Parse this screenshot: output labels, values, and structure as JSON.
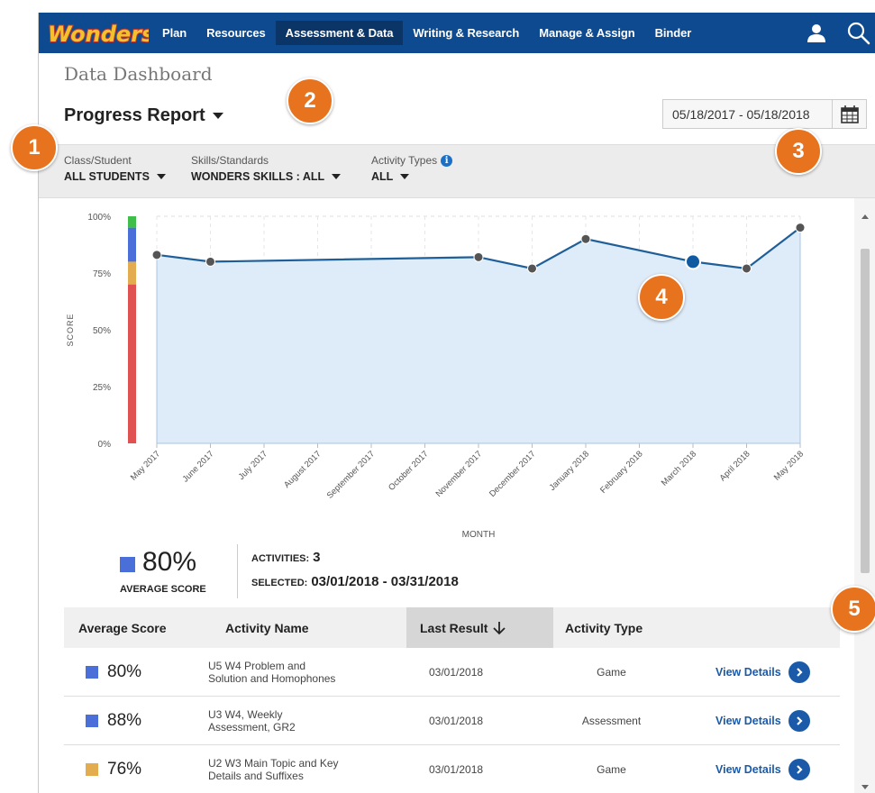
{
  "nav": {
    "logo_text": "Wonders",
    "items": [
      {
        "label": "Plan",
        "active": false
      },
      {
        "label": "Resources",
        "active": false
      },
      {
        "label": "Assessment & Data",
        "active": true
      },
      {
        "label": "Writing & Research",
        "active": false
      },
      {
        "label": "Manage & Assign",
        "active": false
      },
      {
        "label": "Binder",
        "active": false
      }
    ]
  },
  "header": {
    "dashboard_title": "Data Dashboard",
    "report_title": "Progress Report",
    "date_range": "05/18/2017 - 05/18/2018"
  },
  "filters": {
    "class_student_label": "Class/Student",
    "class_student_value": "ALL STUDENTS",
    "skills_label": "Skills/Standards",
    "skills_value": "WONDERS SKILLS : ALL",
    "activity_label": "Activity Types",
    "activity_value": "ALL"
  },
  "chart_data": {
    "type": "area",
    "ylabel": "SCORE",
    "xlabel": "MONTH",
    "ylim": [
      0,
      100
    ],
    "yticks": [
      "0%",
      "25%",
      "50%",
      "75%",
      "100%"
    ],
    "categories": [
      "May 2017",
      "June 2017",
      "July 2017",
      "August 2017",
      "September 2017",
      "October 2017",
      "November 2017",
      "December 2017",
      "January 2018",
      "February 2018",
      "March 2018",
      "April 2018",
      "May 2018"
    ],
    "points": [
      {
        "x": "May 2017",
        "y": 83
      },
      {
        "x": "June 2017",
        "y": 80
      },
      {
        "x": "November 2017",
        "y": 82
      },
      {
        "x": "December 2017",
        "y": 77
      },
      {
        "x": "January 2018",
        "y": 90
      },
      {
        "x": "March 2018",
        "y": 80,
        "selected": true
      },
      {
        "x": "April 2018",
        "y": 77
      },
      {
        "x": "May 2018",
        "y": 95
      }
    ],
    "score_bands": [
      {
        "from": 0,
        "to": 70,
        "color": "#e05252"
      },
      {
        "from": 70,
        "to": 80,
        "color": "#e3ad4f"
      },
      {
        "from": 80,
        "to": 95,
        "color": "#4a6fd8"
      },
      {
        "from": 95,
        "to": 100,
        "color": "#3fbf4a"
      }
    ],
    "line_color": "#1f5f99",
    "fill_color": "#deebf8",
    "grid": true
  },
  "summary": {
    "average_score": "80%",
    "average_label": "AVERAGE SCORE",
    "average_color": "#4a6fd8",
    "activities_label": "ACTIVITIES:",
    "activities_value": "3",
    "selected_label": "SELECTED:",
    "selected_value": "03/01/2018 - 03/31/2018"
  },
  "table": {
    "headers": {
      "average_score": "Average Score",
      "activity_name": "Activity Name",
      "last_result": "Last Result",
      "activity_type": "Activity Type"
    },
    "rows": [
      {
        "score": "80%",
        "color": "#4a6fd8",
        "name": "U5 W4 Problem and Solution and Homophones",
        "date": "03/01/2018",
        "type": "Game",
        "link": "View Details"
      },
      {
        "score": "88%",
        "color": "#4a6fd8",
        "name": "U3 W4, Weekly Assessment, GR2",
        "date": "03/01/2018",
        "type": "Assessment",
        "link": "View Details"
      },
      {
        "score": "76%",
        "color": "#e3ad4f",
        "name": "U2 W3 Main Topic and Key Details and Suffixes",
        "date": "03/01/2018",
        "type": "Game",
        "link": "View Details"
      }
    ]
  },
  "callouts": [
    "1",
    "2",
    "3",
    "4",
    "5"
  ]
}
